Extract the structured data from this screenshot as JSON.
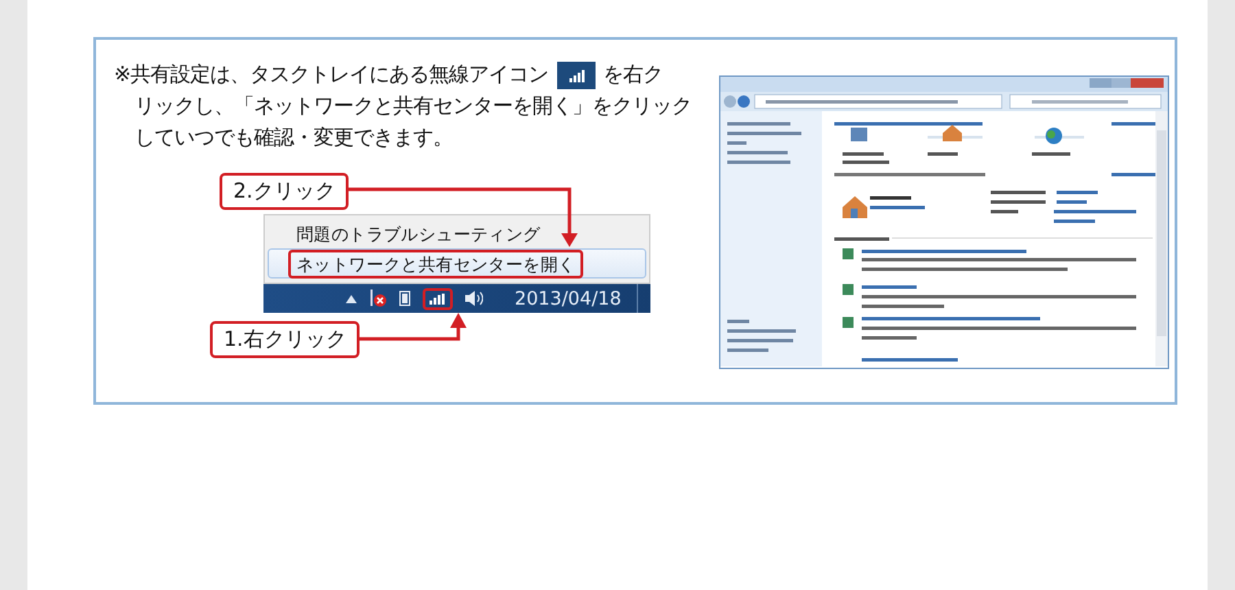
{
  "note": {
    "before_icon": "※共有設定は、タスクトレイにある無線アイコン",
    "after_icon": "を右ク",
    "lines": [
      "リックし、「ネットワークと共有センターを開く」をクリック",
      "していつでも確認・変更できます。"
    ]
  },
  "context_menu": [
    {
      "label": "問題のトラブルシューティング",
      "selected": false
    },
    {
      "label": "ネットワークと共有センターを開く",
      "selected": true
    }
  ],
  "taskbar": {
    "date": "2013/04/18"
  },
  "callouts": [
    {
      "text": "2.クリック",
      "kind": "down"
    },
    {
      "text": "1.右クリック",
      "kind": "up"
    }
  ]
}
